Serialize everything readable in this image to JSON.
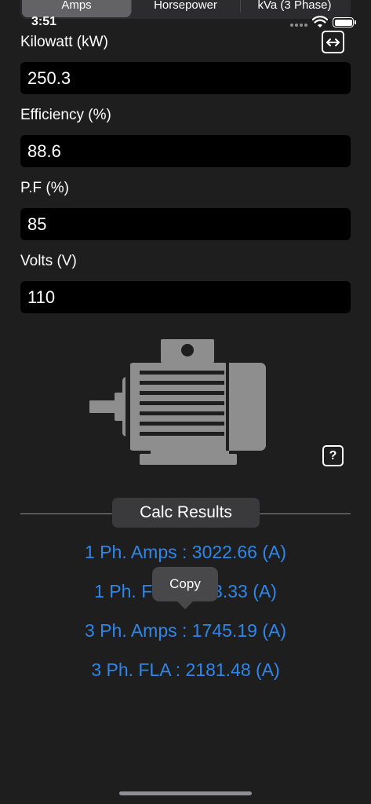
{
  "tabs": [
    {
      "label": "Amps",
      "active": true
    },
    {
      "label": "Horsepower",
      "active": false
    },
    {
      "label": "kVa (3 Phase)",
      "active": false
    }
  ],
  "status_bar": {
    "time": "3:51"
  },
  "fields": {
    "kilowatt": {
      "label": "Kilowatt (kW)",
      "value": "250.3"
    },
    "efficiency": {
      "label": "Efficiency (%)",
      "value": "88.6"
    },
    "power_factor": {
      "label": "P.F (%)",
      "value": "85"
    },
    "volts": {
      "label": "Volts (V)",
      "value": "110"
    }
  },
  "help_label": "?",
  "calc_button": {
    "label": "Calc Results"
  },
  "results": {
    "ph1_amps": "1 Ph. Amps : 3022.66 (A)",
    "ph1_fla": "1 Ph. FLA : 3778.33 (A)",
    "ph1_fla_left": "1 Ph. FL",
    "ph1_fla_right": "3.33 (A)",
    "ph3_amps": "3 Ph. Amps : 1745.19 (A)",
    "ph3_fla": "3 Ph. FLA : 2181.48 (A)"
  },
  "copy_popup": {
    "label": "Copy"
  },
  "colors": {
    "background": "#1e1e1f",
    "accent": "#2f86ea",
    "motor": "#8e8e8e",
    "field": "#000000"
  },
  "icons": [
    "wifi-icon",
    "battery-icon",
    "swap-horizontal-icon",
    "electric-motor-icon",
    "question-icon"
  ]
}
